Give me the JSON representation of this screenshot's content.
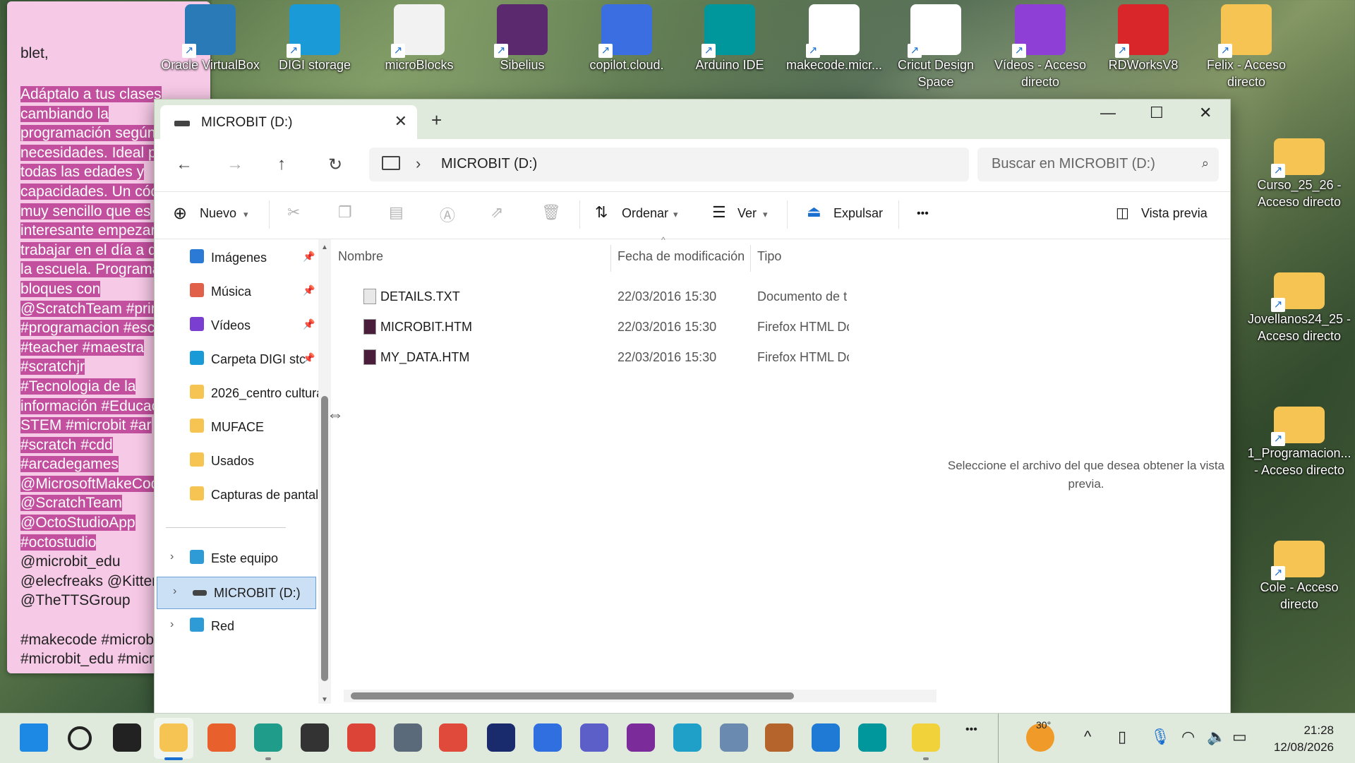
{
  "sticky_note": {
    "intro": "blet,",
    "highlighted_lines": [
      "Adáptalo a tus clases",
      "cambiando la",
      "programación según",
      "necesidades. Ideal pa",
      "todas las edades y",
      "capacidades. Un cód",
      "muy sencillo que es",
      "interesante empezar",
      "trabajar en el día a d",
      "la escuela. Programa",
      "bloques con",
      "@ScratchTeam  #prin",
      "#programacion #esc",
      "#teacher #maestra",
      "#scratchjr",
      "#Tecnologia de la",
      "información #Educac",
      "STEM #microbit  #ar",
      "#scratch #cdd",
      "#arcadegames",
      "@MicrosoftMakeCod",
      "@ScratchTeam",
      "@OctoStudioApp",
      "#octostudio"
    ],
    "plain_lines": [
      "@microbit_edu",
      "@elecfreaks @Kitten",
      "@TheTTSGroup",
      "",
      "#makecode #microb",
      "#microbit_edu #micro"
    ]
  },
  "desktop_icons": [
    {
      "label": "Oracle VirtualBox",
      "color": "#2a7ab8",
      "icon": "virtualbox-icon"
    },
    {
      "label": "DIGI storage",
      "color": "#1a9ad6",
      "icon": "cloud-icon"
    },
    {
      "label": "microBlocks",
      "color": "#f2f2f2",
      "icon": "rabbit-icon"
    },
    {
      "label": "Sibelius",
      "color": "#5b2a6e",
      "icon": "treble-clef-icon"
    },
    {
      "label": "copilot.cloud.",
      "color": "#3b6ee0",
      "icon": "copilot-icon"
    },
    {
      "label": "Arduino IDE",
      "color": "#00979c",
      "icon": "arduino-icon"
    },
    {
      "label": "makecode.micr...",
      "color": "#ffffff",
      "icon": "microbit-icon"
    },
    {
      "label": "Cricut Design Space",
      "color": "#ffffff",
      "icon": "cricut-icon"
    },
    {
      "label": "Vídeos - Acceso directo",
      "color": "#8e3fd6",
      "icon": "video-icon"
    },
    {
      "label": "RDWorksV8",
      "color": "#d9262b",
      "icon": "rdworks-icon"
    },
    {
      "label": "Felix - Acceso directo",
      "color": "#f5c453",
      "icon": "folder-icon"
    }
  ],
  "right_icons": [
    {
      "label": "Curso_25_26 - Acceso directo"
    },
    {
      "label": "Jovellanos24_25 - Acceso directo"
    },
    {
      "label": "1_Programacion... - Acceso directo"
    },
    {
      "label": "Cole - Acceso directo"
    }
  ],
  "window": {
    "tab_title": "MICROBIT (D:)",
    "new_tab": "+",
    "controls": {
      "minimize": "—",
      "maximize": "☐",
      "close": "✕"
    },
    "address_path": "MICROBIT (D:)",
    "search_placeholder": "Buscar en MICROBIT (D:)",
    "toolbar": {
      "new": "Nuevo",
      "sort": "Ordenar",
      "view": "Ver",
      "eject": "Expulsar",
      "more": "•••",
      "preview": "Vista previa"
    },
    "nav_items": [
      {
        "label": "Imágenes",
        "icon": "images-icon",
        "color": "#2a7ad6",
        "pinned": true
      },
      {
        "label": "Música",
        "icon": "music-icon",
        "color": "#e0604a",
        "pinned": true
      },
      {
        "label": "Vídeos",
        "icon": "videos-icon",
        "color": "#7a3fd0",
        "pinned": true
      },
      {
        "label": "Carpeta DIGI stc",
        "icon": "digi-folder-icon",
        "color": "#1a9ad6",
        "pinned": true
      },
      {
        "label": "2026_centro cultura",
        "icon": "folder-icon",
        "color": "#f5c453",
        "pinned": false
      },
      {
        "label": "MUFACE",
        "icon": "folder-icon",
        "color": "#f5c453",
        "pinned": false
      },
      {
        "label": "Usados",
        "icon": "folder-icon",
        "color": "#f5c453",
        "pinned": false
      },
      {
        "label": "Capturas de pantall",
        "icon": "folder-icon",
        "color": "#f5c453",
        "pinned": false
      }
    ],
    "tree_items": [
      {
        "label": "Este equipo",
        "icon": "pc-icon",
        "color": "#2f9bd6"
      },
      {
        "label": "MICROBIT (D:)",
        "icon": "drive-icon",
        "color": "#444444"
      },
      {
        "label": "Red",
        "icon": "network-icon",
        "color": "#2f9bd6"
      }
    ],
    "columns": {
      "name": "Nombre",
      "date": "Fecha de modificación",
      "type": "Tipo"
    },
    "files": [
      {
        "name": "DETAILS.TXT",
        "date": "22/03/2016 15:30",
        "type": "Documento de t",
        "icon": "text-file-icon"
      },
      {
        "name": "MICROBIT.HTM",
        "date": "22/03/2016 15:30",
        "type": "Firefox HTML Dc",
        "icon": "firefox-html-icon"
      },
      {
        "name": "MY_DATA.HTM",
        "date": "22/03/2016 15:30",
        "type": "Firefox HTML Dc",
        "icon": "firefox-html-icon"
      }
    ],
    "preview_message": "Seleccione el archivo del que desea obtener la vista previa."
  },
  "taskbar": {
    "apps": [
      {
        "name": "start",
        "color": "#1e88e5"
      },
      {
        "name": "search",
        "color": "#222222"
      },
      {
        "name": "task-view",
        "color": "#222222"
      },
      {
        "name": "file-explorer",
        "color": "#f5c453"
      },
      {
        "name": "firefox",
        "color": "#e8602c"
      },
      {
        "name": "edge",
        "color": "#1f9d8a"
      },
      {
        "name": "inkscape",
        "color": "#333333"
      },
      {
        "name": "chrome",
        "color": "#db4437"
      },
      {
        "name": "settings",
        "color": "#5a6a7a"
      },
      {
        "name": "notepad",
        "color": "#e04a3a"
      },
      {
        "name": "audition",
        "color": "#1a2b6d"
      },
      {
        "name": "power-automate",
        "color": "#2f6fe0"
      },
      {
        "name": "teams",
        "color": "#5b5fc7"
      },
      {
        "name": "app-purple",
        "color": "#7b2c9a"
      },
      {
        "name": "edu",
        "color": "#1fa0c8"
      },
      {
        "name": "photos",
        "color": "#6a8ab0"
      },
      {
        "name": "app-brown",
        "color": "#b5652c"
      },
      {
        "name": "vscode",
        "color": "#1f7ad6"
      },
      {
        "name": "arduino",
        "color": "#00979c"
      },
      {
        "name": "sticky-notes",
        "color": "#f2d23a"
      }
    ],
    "weather": "30°",
    "time": "21:28",
    "date": "12/08/2026"
  }
}
